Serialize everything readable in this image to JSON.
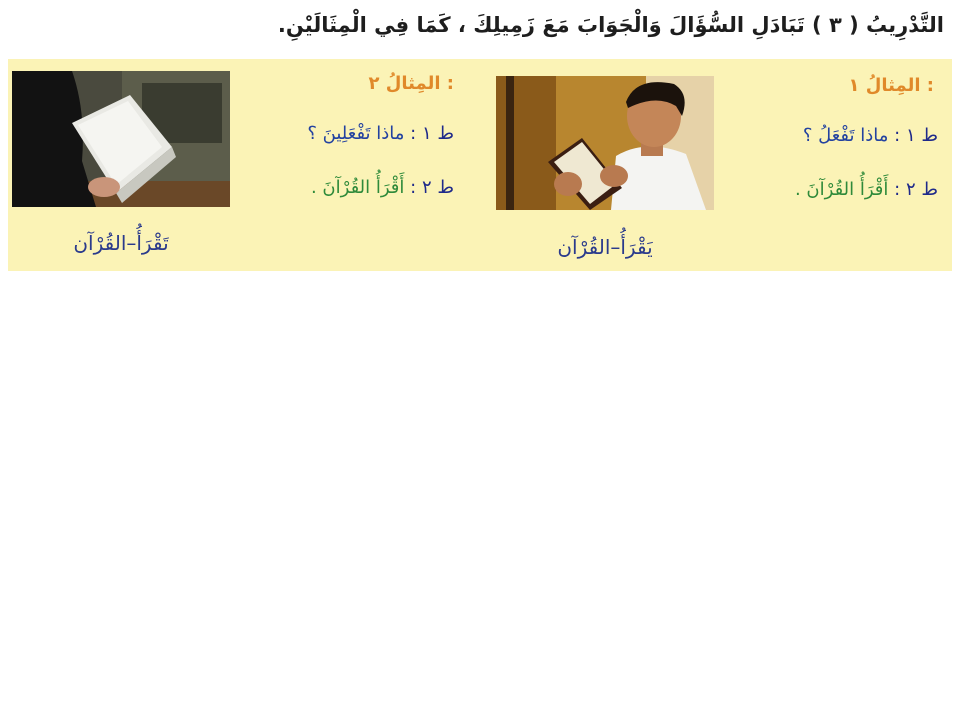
{
  "title": "التَّدْرِيبُ ( ٣ ) تَبَادَلِ السُّؤَالَ وَالْجَوَابَ مَعَ زَمِيلِكَ ، كَمَا فِي الْمِثَالَيْنِ.",
  "colors": {
    "panel_bg": "#fbf3b6",
    "heading": "#e0892a",
    "question": "#2342a0",
    "answer": "#2f8a3a",
    "speaker": "#1f2a8a",
    "caption": "#2a3a8c"
  },
  "examples": [
    {
      "heading": "المِثالُ ١ :",
      "q_speaker": "ط ١ :",
      "q_text": "ماذا تَفْعَلُ ؟",
      "a_speaker": "ط ٢ :",
      "a_text": "أَقْرَأُ القُرْآنَ .",
      "caption": "يَقْرَأُ–القُرْآن",
      "photo": "boy-reading-quran"
    },
    {
      "heading": "المِثالُ ٢ :",
      "q_speaker": "ط ١ :",
      "q_text": "ماذا تَفْعَلِينَ ؟",
      "a_speaker": "ط ٢ :",
      "a_text": "أَقْرَأُ القُرْآنَ .",
      "caption": "تَقْرَأُ–القُرْآن",
      "photo": "woman-holding-quran"
    }
  ]
}
